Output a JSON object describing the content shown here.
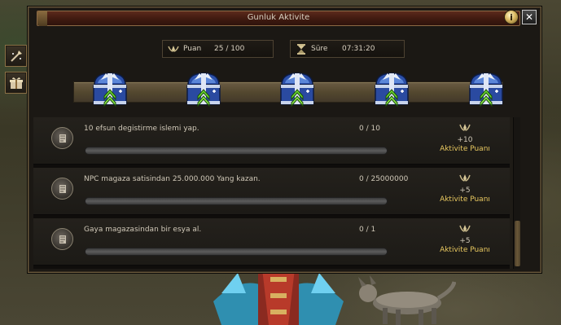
{
  "window": {
    "title": "Gunluk Aktivite",
    "info_icon": "info-icon",
    "close_icon": "close-icon"
  },
  "side_buttons": [
    {
      "icon": "wand-icon"
    },
    {
      "icon": "gift-box-icon"
    }
  ],
  "points": {
    "label": "Puan",
    "value": "25 / 100",
    "icon": "activity-points-icon"
  },
  "time": {
    "label": "Süre",
    "value": "07:31:20",
    "icon": "hourglass-icon"
  },
  "chests": [
    {
      "icon": "reward-chest-icon"
    },
    {
      "icon": "reward-chest-icon"
    },
    {
      "icon": "reward-chest-icon"
    },
    {
      "icon": "reward-chest-icon"
    },
    {
      "icon": "reward-chest-icon"
    }
  ],
  "tasks": [
    {
      "description": "10 efsun degistirme islemi yap.",
      "count": "0 / 10",
      "progress": 0,
      "reward_amount": "+10",
      "reward_label": "Aktivite Puanı",
      "icon": "task-scroll-icon"
    },
    {
      "description": "NPC magaza satisindan 25.000.000 Yang kazan.",
      "count": "0 / 25000000",
      "progress": 0,
      "reward_amount": "+5",
      "reward_label": "Aktivite Puanı",
      "icon": "task-scroll-icon"
    },
    {
      "description": "Gaya magazasindan bir esya al.",
      "count": "0 / 1",
      "progress": 0,
      "reward_amount": "+5",
      "reward_label": "Aktivite Puanı",
      "icon": "task-scroll-icon"
    }
  ],
  "colors": {
    "title_bar": "#4a1f14",
    "reward_text": "#e8c860",
    "window_bg": "#1b1814"
  }
}
